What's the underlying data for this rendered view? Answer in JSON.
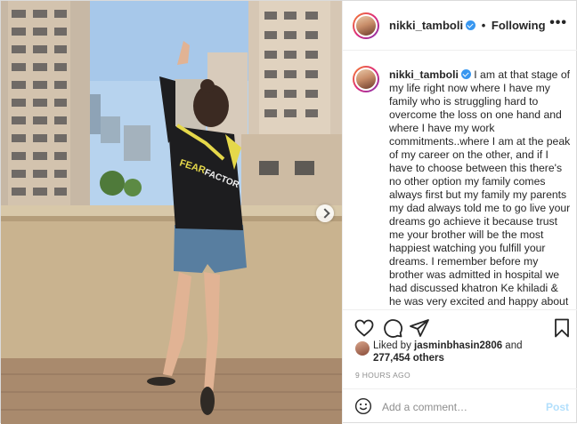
{
  "header": {
    "username": "nikki_tamboli",
    "separator": "•",
    "follow_status": "Following",
    "more_label": "•••"
  },
  "caption": {
    "username": "nikki_tamboli",
    "text": "I am at that stage of my life right now where I have my family who is struggling hard to overcome the loss on one hand and where I have my work commitments..where I am at the peak of my career on the other, and if I have to choose between this there's no other option my family comes always first but my family my parents my dad always told me to go live your dreams go achieve it because trust me your brother will be the most happiest watching you fulfill your dreams. I remember before my brother was admitted in hospital we had discussed khatron Ke khiladi & he was very excited and happy about it."
  },
  "photo": {
    "jacket_text_1": "FEAR",
    "jacket_text_2": "FACTOR"
  },
  "actions": {
    "like_icon": "heart-icon",
    "comment_icon": "comment-bubble-icon",
    "share_icon": "paper-plane-icon",
    "save_icon": "bookmark-icon"
  },
  "likes": {
    "prefix": "Liked by ",
    "liker": "jasminbhasin2806",
    "middle": " and",
    "count": "277,454 others"
  },
  "timestamp": "9 HOURS AGO",
  "comment_box": {
    "placeholder": "Add a comment…",
    "post_label": "Post"
  },
  "colors": {
    "accent": "#3897f0",
    "post_disabled": "#b2dffc",
    "muted": "#8e8e8e",
    "border": "#dbdbdb"
  }
}
